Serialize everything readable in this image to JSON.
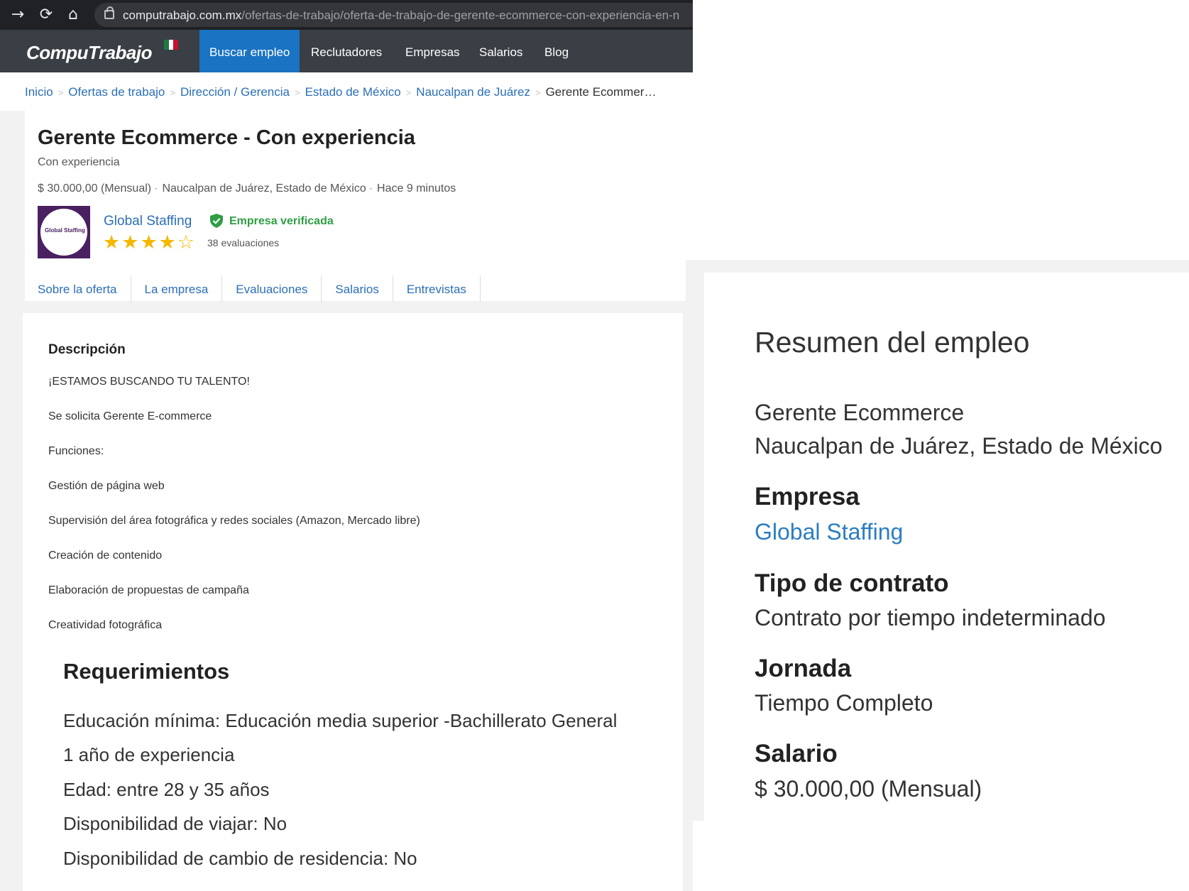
{
  "browser": {
    "url_host": "computrabajo.com.mx",
    "url_path": "/ofertas-de-trabajo/oferta-de-trabajo-de-gerente-ecommerce-con-experiencia-en-n"
  },
  "site": {
    "logo": "CompuTrabajo",
    "nav": [
      "Buscar empleo",
      "Reclutadores",
      "Empresas",
      "Salarios",
      "Blog"
    ]
  },
  "breadcrumb": [
    "Inicio",
    "Ofertas de trabajo",
    "Dirección / Gerencia",
    "Estado de México",
    "Naucalpan de Juárez",
    "Gerente Ecommer…"
  ],
  "job": {
    "title": "Gerente Ecommerce - Con experiencia",
    "subtitle": "Con experiencia",
    "salary": "$ 30.000,00 (Mensual)",
    "location": "Naucalpan de Juárez, Estado de México",
    "posted": "Hace 9 minutos"
  },
  "company": {
    "logo_text": "Global Staffing",
    "name": "Global Staffing",
    "verified": "Empresa verificada",
    "rating": 4,
    "rating_max": 5,
    "reviews": "38 evaluaciones"
  },
  "tabs": [
    "Sobre la oferta",
    "La empresa",
    "Evaluaciones",
    "Salarios",
    "Entrevistas"
  ],
  "description": {
    "heading": "Descripción",
    "lines": [
      "¡ESTAMOS BUSCANDO TU TALENTO!",
      "Se solicita Gerente E-commerce",
      "Funciones:",
      "Gestión de página web",
      "Supervisión del área fotográfica y redes sociales (Amazon, Mercado libre)",
      "Creación de contenido",
      "Elaboración de propuestas de campaña",
      "Creatividad fotográfica"
    ]
  },
  "requirements": {
    "heading": "Requerimientos",
    "lines": [
      "Educación mínima: Educación media superior -Bachillerato General",
      "1 año de experiencia",
      "Edad: entre 28 y 35 años",
      "Disponibilidad de viajar: No",
      "Disponibilidad de cambio de residencia: No"
    ]
  },
  "summary": {
    "title": "Resumen del empleo",
    "job": "Gerente Ecommerce",
    "location": "Naucalpan de Juárez, Estado de México",
    "company_label": "Empresa",
    "company": "Global Staffing",
    "contract_label": "Tipo de contrato",
    "contract": "Contrato por tiempo indeterminado",
    "schedule_label": "Jornada",
    "schedule": "Tiempo Completo",
    "salary_label": "Salario",
    "salary": "$ 30.000,00 (Mensual)"
  }
}
